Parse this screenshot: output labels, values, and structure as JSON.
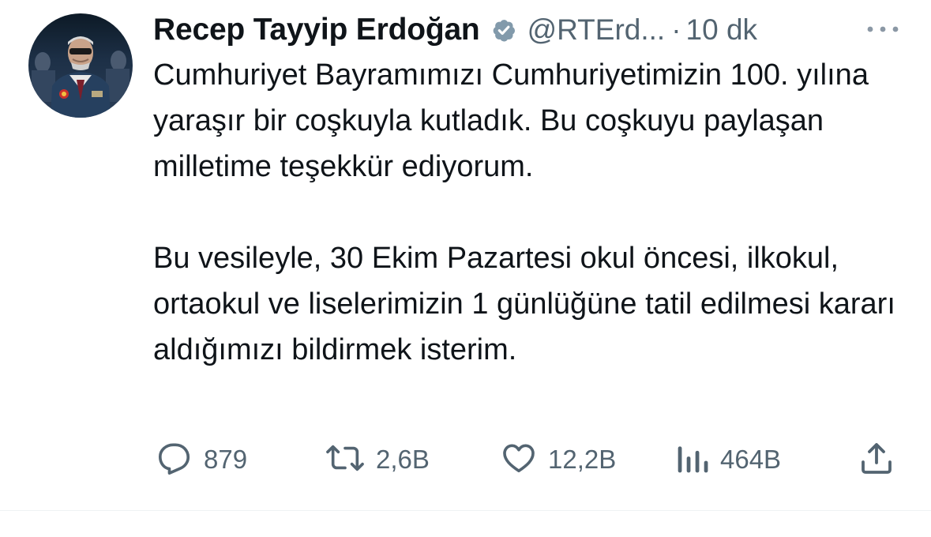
{
  "tweet": {
    "author": {
      "display_name": "Recep Tayyip Erdoğan",
      "verified_icon": "verified-badge-icon",
      "handle": "@RTErd...",
      "separator": "·",
      "time": "10 dk"
    },
    "more_icon": "more-horizontal-icon",
    "text": {
      "paragraph_1": "Cumhuriyet Bayramımızı Cumhuriyetimizin 100. yılına yaraşır bir coşkuyla kutladık. Bu coşkuyu paylaşan milletime teşekkür ediyorum.",
      "paragraph_2": "Bu vesileyle, 30 Ekim Pazartesi okul öncesi, ilkokul, ortaokul ve liselerimizin 1 günlüğüne tatil edilmesi kararı aldığımızı bildirmek isterim."
    },
    "actions": {
      "reply": {
        "icon": "reply-icon",
        "count": "879"
      },
      "retweet": {
        "icon": "retweet-icon",
        "count": "2,6B"
      },
      "like": {
        "icon": "heart-icon",
        "count": "12,2B"
      },
      "views": {
        "icon": "views-chart-icon",
        "count": "464B"
      },
      "share": {
        "icon": "share-icon"
      }
    }
  },
  "colors": {
    "text_primary": "#0f1419",
    "text_secondary": "#536471",
    "divider": "#eff3f4",
    "verified_badge": "#829aab"
  }
}
